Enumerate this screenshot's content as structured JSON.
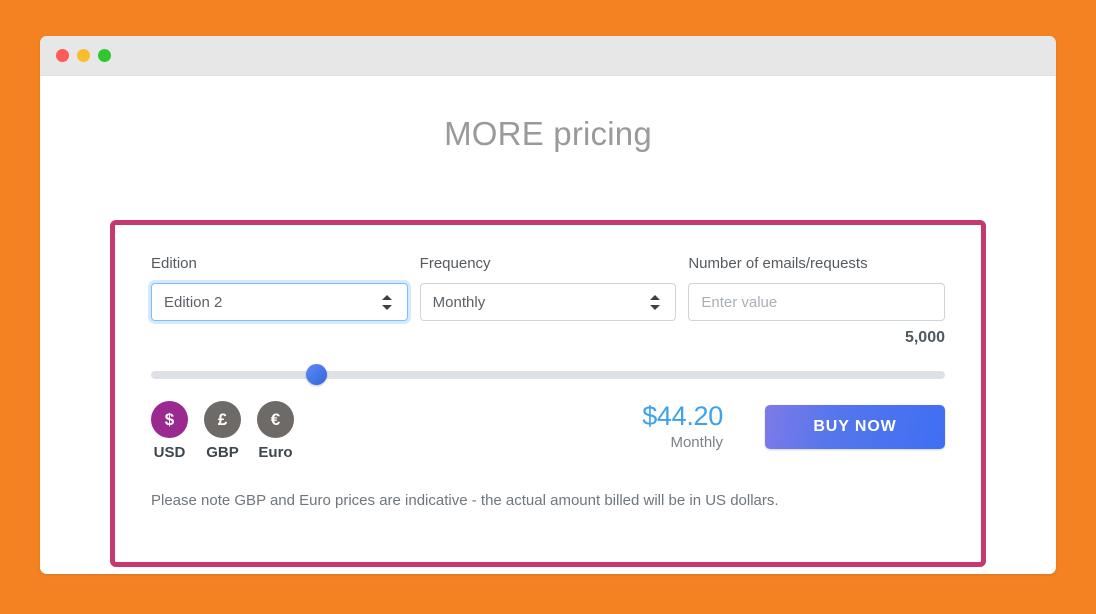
{
  "theme": {
    "page_background": "#f58220",
    "panel_border": "#c4396f",
    "accent_blue": "#3aa3ec",
    "active_currency": "#9a2a8f",
    "inactive_currency": "#6d6a67",
    "button_gradient_from": "#7e7ae8",
    "button_gradient_to": "#3f6ff3",
    "slider_thumb": "#3366dd",
    "slider_track": "#dee2e6"
  },
  "window": {
    "traffic_lights": {
      "close": "close-button",
      "minimize": "minimize-button",
      "zoom": "zoom-button"
    }
  },
  "page": {
    "title": "MORE pricing"
  },
  "form": {
    "edition": {
      "label": "Edition",
      "value": "Edition 2",
      "icon": "select-arrows-icon"
    },
    "frequency": {
      "label": "Frequency",
      "value": "Monthly",
      "icon": "select-arrows-icon"
    },
    "quantity": {
      "label": "Number of emails/requests",
      "value": "",
      "placeholder": "Enter value"
    }
  },
  "slider": {
    "display_value": "5,000",
    "position_percent": 20.8
  },
  "currencies": [
    {
      "code": "USD",
      "symbol": "$",
      "label": "USD",
      "active": true
    },
    {
      "code": "GBP",
      "symbol": "£",
      "label": "GBP",
      "active": false
    },
    {
      "code": "EUR",
      "symbol": "€",
      "label": "Euro",
      "active": false
    }
  ],
  "price": {
    "amount": "$44.20",
    "period": "Monthly"
  },
  "buy": {
    "label": "BUY NOW"
  },
  "note": {
    "text": "Please note GBP and Euro prices are indicative - the actual amount billed will be in US dollars."
  }
}
